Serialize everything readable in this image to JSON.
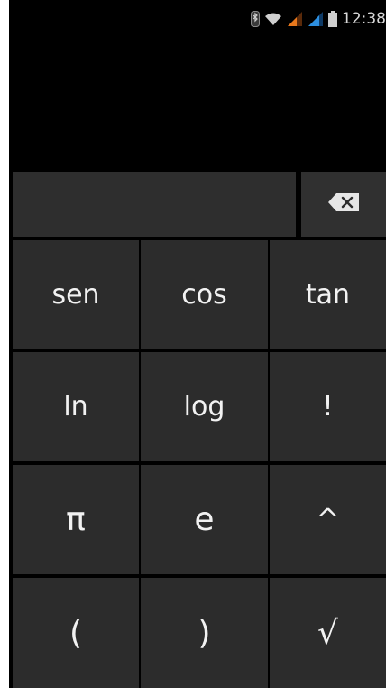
{
  "status_bar": {
    "time": "12:38",
    "icons": [
      "bluetooth-icon",
      "wifi-icon",
      "signal-orange-icon",
      "signal-blue-icon",
      "battery-icon"
    ],
    "colors": {
      "signal_orange": "#e8781c",
      "signal_blue": "#2d8fe0",
      "icon_gray": "#cfcfcf"
    }
  },
  "display": {
    "result": ""
  },
  "formula": {
    "value": ""
  },
  "backspace": {
    "icon": "backspace-icon"
  },
  "keypad": {
    "keys": [
      {
        "id": "sen",
        "label": "sen"
      },
      {
        "id": "cos",
        "label": "cos"
      },
      {
        "id": "tan",
        "label": "tan"
      },
      {
        "id": "ln",
        "label": "ln"
      },
      {
        "id": "log",
        "label": "log"
      },
      {
        "id": "factorial",
        "label": "!"
      },
      {
        "id": "pi",
        "label": "π"
      },
      {
        "id": "e",
        "label": "e"
      },
      {
        "id": "power",
        "label": "^"
      },
      {
        "id": "open-paren",
        "label": "("
      },
      {
        "id": "close-paren",
        "label": ")"
      },
      {
        "id": "sqrt",
        "label": "√"
      }
    ]
  },
  "theme": {
    "background": "#000000",
    "key": "#2c2c2c",
    "text": "#f2f2f2"
  }
}
